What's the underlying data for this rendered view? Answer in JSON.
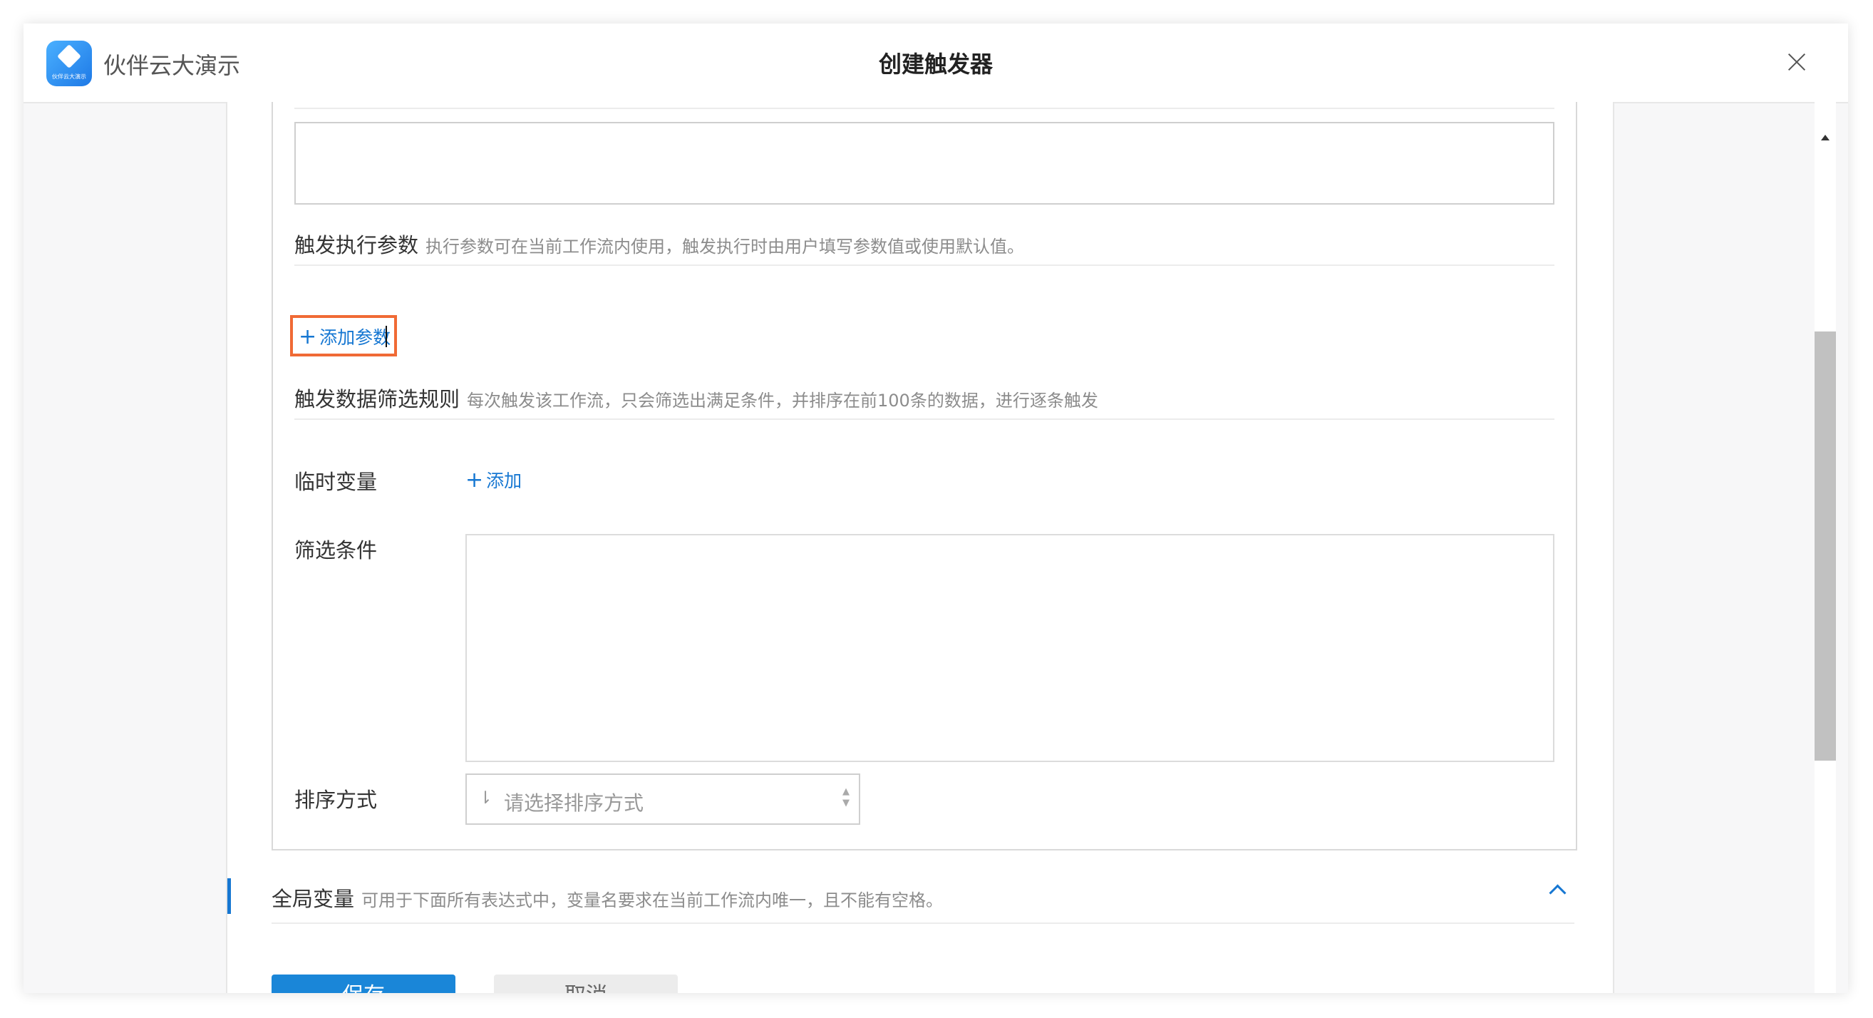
{
  "app": {
    "name": "伙伴云大演示",
    "logo_text": "伙伴云大演示",
    "brand_color": "#1e79e6"
  },
  "dialog": {
    "title": "创建触发器",
    "close_icon": "close-icon"
  },
  "trigger_params": {
    "title": "触发执行参数",
    "hint": "执行参数可在当前工作流内使用，触发执行时由用户填写参数值或使用默认值。",
    "add_label": "添加参数",
    "highlight_color": "#f06a35"
  },
  "filter_rules": {
    "title": "触发数据筛选规则",
    "hint": "每次触发该工作流，只会筛选出满足条件，并排序在前100条的数据，进行逐条触发",
    "temp_var_label": "临时变量",
    "temp_var_add": "添加",
    "condition_label": "筛选条件",
    "sort_label": "排序方式",
    "sort_placeholder": "请选择排序方式"
  },
  "global_vars": {
    "title": "全局变量",
    "hint": "可用于下面所有表达式中，变量名要求在当前工作流内唯一，且不能有空格。",
    "accent_color": "#1677d2"
  },
  "actions": {
    "save": "保存",
    "cancel": "取消"
  }
}
